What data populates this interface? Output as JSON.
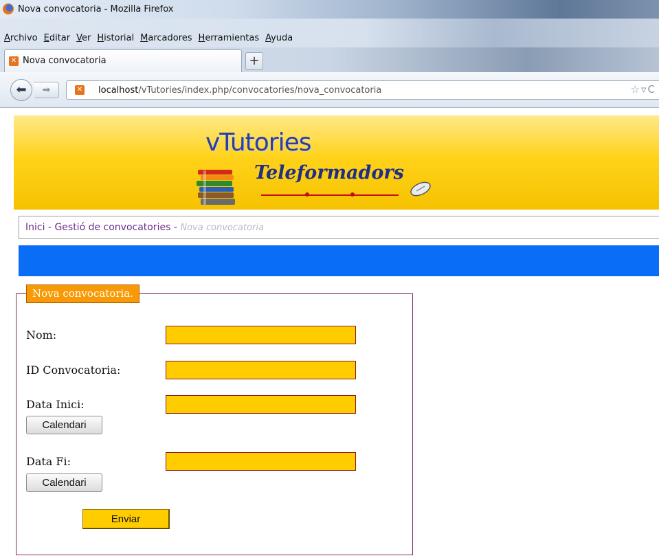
{
  "window": {
    "title": "Nova convocatoria - Mozilla Firefox"
  },
  "menu": {
    "items": [
      "Archivo",
      "Editar",
      "Ver",
      "Historial",
      "Marcadores",
      "Herramientas",
      "Ayuda"
    ]
  },
  "tab": {
    "title": "Nova convocatoria",
    "new_tab": "+"
  },
  "urlbar": {
    "host": "localhost",
    "path": "/vTutories/index.php/convocatories/nova_convocatoria"
  },
  "banner": {
    "title": "vTutories",
    "subtitle": "Teleformadors"
  },
  "breadcrumb": {
    "home": "Inici",
    "sep": " - ",
    "section": "Gestió de convocatories",
    "current": "Nova convocatoria"
  },
  "form": {
    "legend": "Nova convocatoria.",
    "nom_label": "Nom:",
    "nom_value": "",
    "id_label": "ID Convocatoria:",
    "id_value": "",
    "data_inici_label": "Data Inici:",
    "data_inici_value": "",
    "data_fi_label": "Data Fi:",
    "data_fi_value": "",
    "calendar_label": "Calendari",
    "submit_label": "Enviar"
  },
  "colors": {
    "field_bg": "#ffcc00",
    "legend_bg": "#f79a06",
    "bluebar": "#0a6df5",
    "link": "#6b2a8c"
  }
}
